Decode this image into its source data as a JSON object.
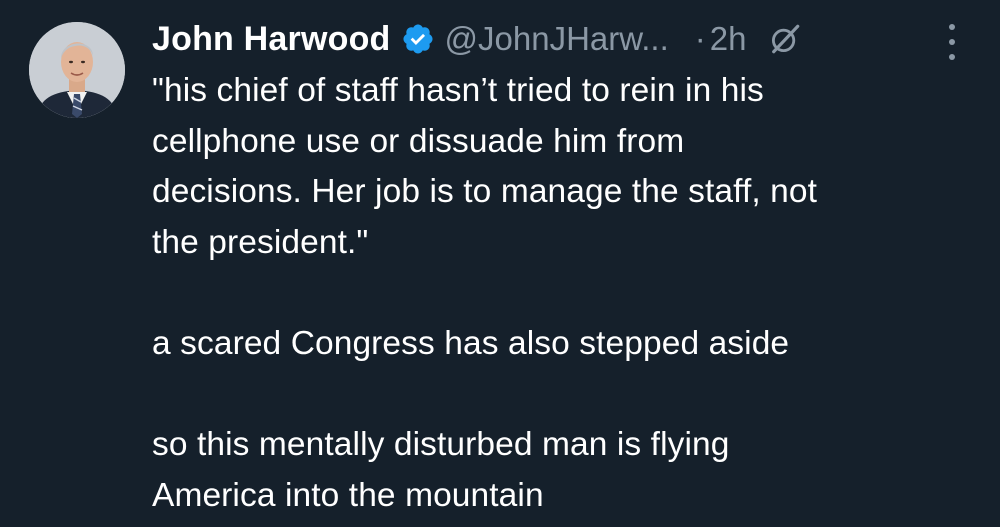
{
  "tweet": {
    "author": {
      "display_name": "John Harwood",
      "handle": "@JohnJHarw...",
      "verified_icon": "verified-badge-icon",
      "avatar_icon": "avatar-photo"
    },
    "dot_separator": "·",
    "timestamp": "2h",
    "visibility_icon": "grok-icon",
    "more_icon": "more-vertical-icon",
    "text_lines": [
      "\"his chief of staff hasn’t tried to rein in his",
      "cellphone use or dissuade him from",
      "decisions. Her job is to manage the staff, not",
      "the president.\"",
      "",
      "a scared Congress has also stepped aside",
      "",
      "so this mentally disturbed man is flying",
      "America into the mountain"
    ]
  },
  "colors": {
    "background": "#15202b",
    "text_primary": "#ffffff",
    "text_secondary": "#8b98a5",
    "verified_blue": "#1d9bf0"
  }
}
